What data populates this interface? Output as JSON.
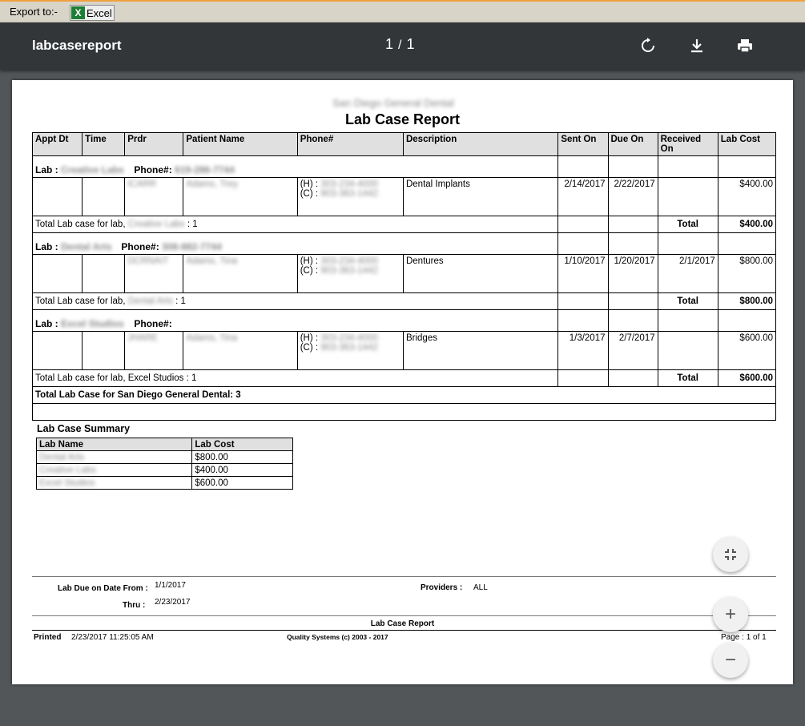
{
  "export": {
    "label": "Export to:-",
    "excel_label": "Excel",
    "excel_icon": "excel-icon"
  },
  "toolbar": {
    "title": "labcasereport",
    "page_current": "1",
    "page_sep": "/",
    "page_total": "1"
  },
  "report": {
    "org_name": "San Diego General Dental",
    "title": "Lab Case Report",
    "columns": [
      "Appt Dt",
      "Time",
      "Prdr",
      "Patient Name",
      "Phone#",
      "Description",
      "Sent On",
      "Due On",
      "Received On",
      "Lab Cost"
    ],
    "lab_prefix": "Lab :",
    "phone_prefix": "Phone#:",
    "total_prefix": "Total Lab case for lab,",
    "total_label": "Total",
    "h_label": "(H) :",
    "c_label": "(C) :",
    "labs": [
      {
        "name": "Creative Labs",
        "phone": "619-286-7744",
        "prdr": "ICARR",
        "patient": "Adams, Trey",
        "home": "303-234-4000",
        "cell": "903-363-1442",
        "description": "Dental Implants",
        "sent_on": "2/14/2017",
        "due_on": "2/22/2017",
        "received_on": "",
        "cost": "$400.00",
        "count": ": 1",
        "total_cost": "$400.00"
      },
      {
        "name": "Dental Arts",
        "phone": "308-882-7744",
        "prdr": "DCRNAIT",
        "patient": "Adams, Tina",
        "home": "303-234-4000",
        "cell": "903-363-1442",
        "description": "Dentures",
        "sent_on": "1/10/2017",
        "due_on": "1/20/2017",
        "received_on": "2/1/2017",
        "cost": "$800.00",
        "count": ": 1",
        "total_cost": "$800.00"
      },
      {
        "name": "Excel Studios",
        "phone": "",
        "prdr": "JHARE",
        "patient": "Adams, Tina",
        "home": "303-234-4000",
        "cell": "903-363-1442",
        "description": "Bridges",
        "sent_on": "1/3/2017",
        "due_on": "2/7/2017",
        "received_on": "",
        "cost": "$600.00",
        "count": ": 1",
        "total_cost": "$600.00"
      }
    ],
    "grand_total": "Total Lab Case for San Diego General Dental: 3"
  },
  "summary": {
    "title": "Lab Case Summary",
    "columns": [
      "Lab Name",
      "Lab Cost"
    ],
    "rows": [
      {
        "name": "Dental Arts",
        "cost": "$800.00"
      },
      {
        "name": "Creative Labs",
        "cost": "$400.00"
      },
      {
        "name": "Excel Studios",
        "cost": "$600.00"
      }
    ]
  },
  "footer": {
    "due_from_label": "Lab Due on Date From :",
    "due_from": "1/1/2017",
    "thru_label": "Thru :",
    "thru": "2/23/2017",
    "providers_label": "Providers :",
    "providers": "ALL",
    "report_name": "Lab Case Report",
    "printed_label": "Printed",
    "printed": "2/23/2017 11:25:05 AM",
    "copyright": "Quality Systems (c) 2003 - 2017",
    "page": "Page : 1 of 1"
  },
  "fabs": {
    "fit": "fit-to-page-icon",
    "zoom_in": "+",
    "zoom_out": "−"
  }
}
